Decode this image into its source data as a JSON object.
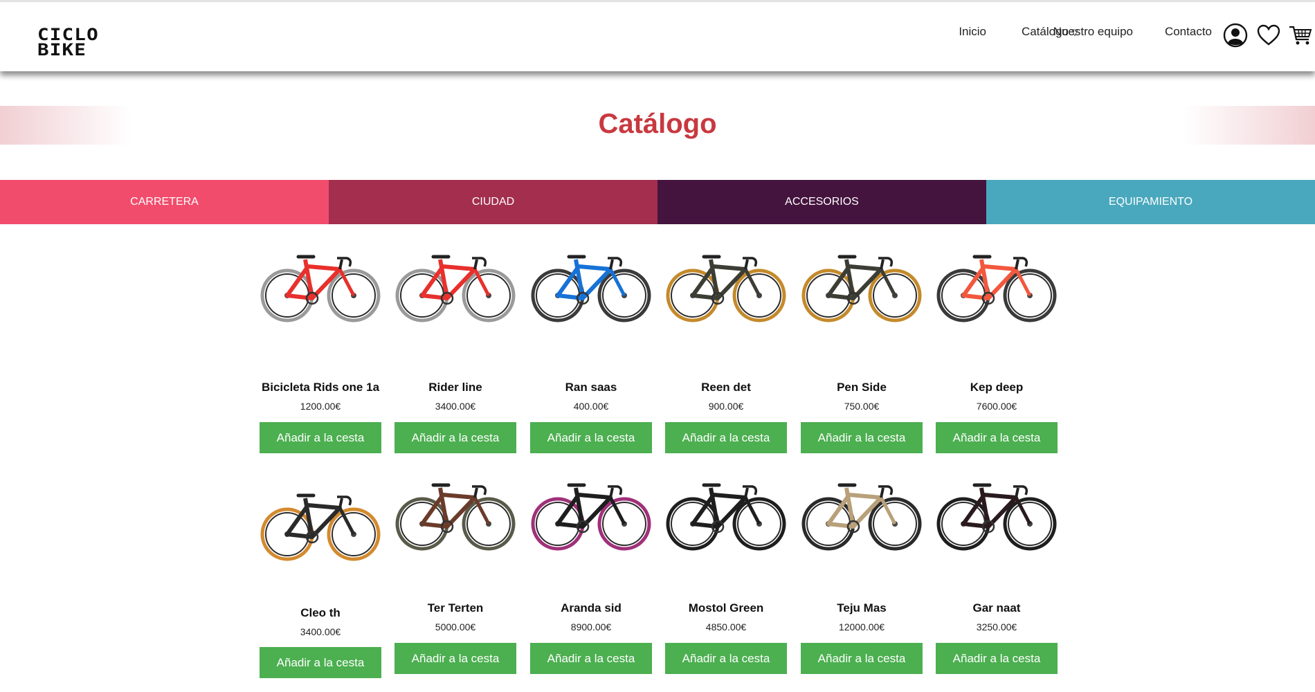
{
  "brand": {
    "logo_text": "CICLO BIKE"
  },
  "nav": {
    "links": [
      "Inicio",
      "Catálogo",
      "Nuestro equipo",
      "Contacto"
    ],
    "catalog_caret": "▽"
  },
  "page": {
    "title": "Catálogo"
  },
  "categories": [
    {
      "label": "CARRETERA",
      "color": "#f24c6c"
    },
    {
      "label": "CIUDAD",
      "color": "#a32e4e"
    },
    {
      "label": "ACCESORIOS",
      "color": "#44143e"
    },
    {
      "label": "EQUIPAMIENTO",
      "color": "#49a8bd"
    }
  ],
  "products": [
    {
      "name": "Bicicleta Rids one 1a",
      "price": "1200.00€",
      "button": "Añadir a la cesta",
      "frame_color": "#e8302c",
      "rim_color": "#9a9a9a"
    },
    {
      "name": "Rider line",
      "price": "3400.00€",
      "button": "Añadir a la cesta",
      "frame_color": "#e8302c",
      "rim_color": "#9a9a9a"
    },
    {
      "name": "Ran saas",
      "price": "400.00€",
      "button": "Añadir a la cesta",
      "frame_color": "#1672d6",
      "rim_color": "#3a3a3a"
    },
    {
      "name": "Reen det",
      "price": "900.00€",
      "button": "Añadir a la cesta",
      "frame_color": "#3c3d34",
      "rim_color": "#c48a2b"
    },
    {
      "name": "Pen Side",
      "price": "750.00€",
      "button": "Añadir a la cesta",
      "frame_color": "#3c3d34",
      "rim_color": "#c48a2b"
    },
    {
      "name": "Kep deep",
      "price": "7600.00€",
      "button": "Añadir a la cesta",
      "frame_color": "#f2583e",
      "rim_color": "#3a3a3a"
    },
    {
      "name": "Cleo th",
      "price": "3400.00€",
      "button": "Añadir a la cesta",
      "frame_color": "#2a2a2a",
      "rim_color": "#d38a2e"
    },
    {
      "name": "Ter Terten",
      "price": "5000.00€",
      "button": "Añadir a la cesta",
      "frame_color": "#6b3b2a",
      "rim_color": "#5a5a4a"
    },
    {
      "name": "Aranda sid",
      "price": "8900.00€",
      "button": "Añadir a la cesta",
      "frame_color": "#1e1e1e",
      "rim_color": "#a0307a"
    },
    {
      "name": "Mostol Green",
      "price": "4850.00€",
      "button": "Añadir a la cesta",
      "frame_color": "#1e1e1e",
      "rim_color": "#1e1e1e"
    },
    {
      "name": "Teju Mas",
      "price": "12000.00€",
      "button": "Añadir a la cesta",
      "frame_color": "#b8a07a",
      "rim_color": "#2a2a2a"
    },
    {
      "name": "Gar naat",
      "price": "3250.00€",
      "button": "Añadir a la cesta",
      "frame_color": "#2a1a1e",
      "rim_color": "#1e1e1e"
    }
  ]
}
